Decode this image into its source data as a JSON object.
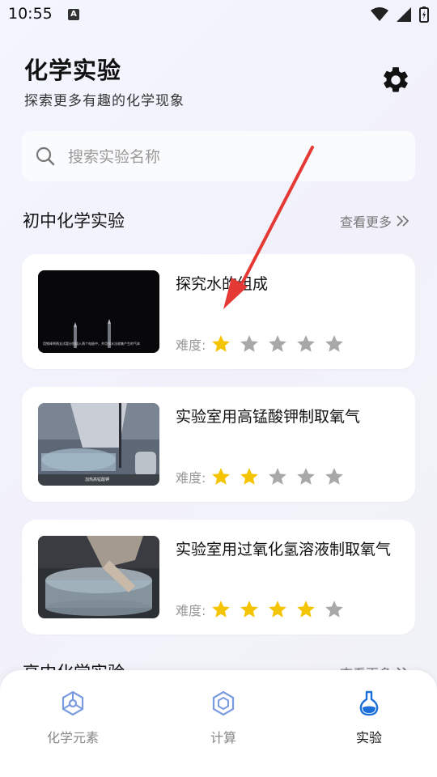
{
  "status": {
    "time": "10:55",
    "a_badge": "A"
  },
  "header": {
    "title": "化学实验",
    "subtitle": "探索更多有趣的化学现象"
  },
  "search": {
    "placeholder": "搜索实验名称"
  },
  "sections": [
    {
      "title": "初中化学实验",
      "more": "查看更多"
    },
    {
      "title": "高中化学实验",
      "more": "查看更多"
    }
  ],
  "difficulty_label": "难度:",
  "experiments": [
    {
      "title": "探究水的组成",
      "difficulty": 1,
      "thumb_caption": "用铁棒将两支试管分别插入两个电极中，并用排水法收集产生的气体"
    },
    {
      "title": "实验室用高锰酸钾制取氧气",
      "difficulty": 2,
      "thumb_caption": "加热高锰酸钾"
    },
    {
      "title": "实验室用过氧化氢溶液制取氧气",
      "difficulty": 4,
      "thumb_caption": ""
    }
  ],
  "tabs": [
    {
      "label": "化学元素",
      "icon": "molecule-icon",
      "active": false
    },
    {
      "label": "计算",
      "icon": "hexagon-icon",
      "active": false
    },
    {
      "label": "实验",
      "icon": "flask-icon",
      "active": true
    }
  ],
  "colors": {
    "star_active": "#f5c400",
    "star_inactive": "#a8a8a8",
    "tab_active": "#1b6fd8",
    "tab_inactive": "#7a9be0"
  }
}
